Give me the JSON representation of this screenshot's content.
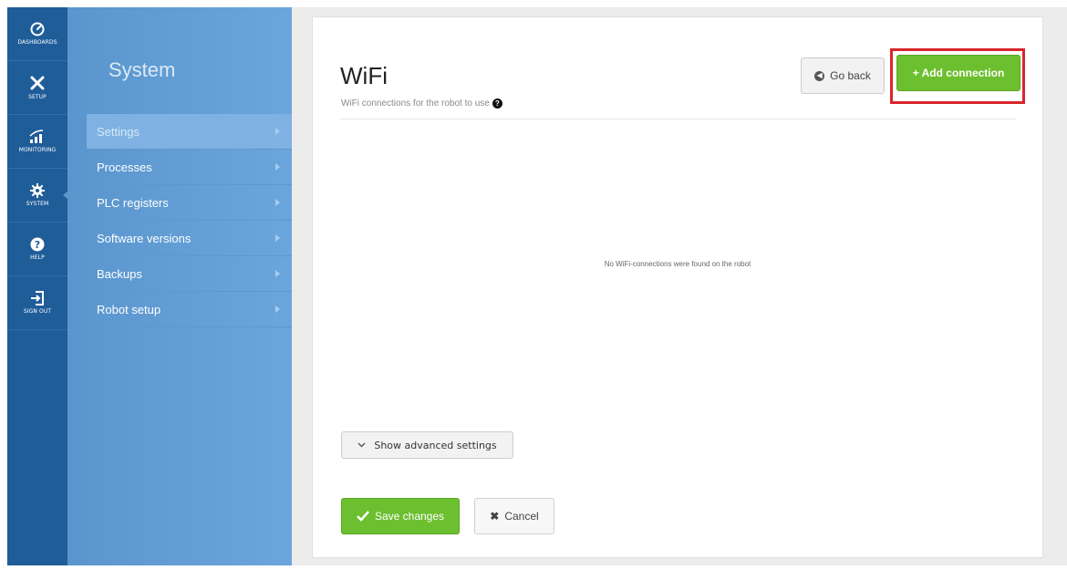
{
  "rail": {
    "items": [
      {
        "label": "DASHBOARDS",
        "icon": "dashboard-icon"
      },
      {
        "label": "SETUP",
        "icon": "tools-icon"
      },
      {
        "label": "MONITORING",
        "icon": "signal-icon"
      },
      {
        "label": "SYSTEM",
        "icon": "gear-icon",
        "active": true
      },
      {
        "label": "HELP",
        "icon": "question-icon"
      },
      {
        "label": "SIGN OUT",
        "icon": "sign-out-icon"
      }
    ]
  },
  "submenu": {
    "title": "System",
    "items": [
      {
        "label": "Settings",
        "active": true
      },
      {
        "label": "Processes"
      },
      {
        "label": "PLC registers"
      },
      {
        "label": "Software versions"
      },
      {
        "label": "Backups"
      },
      {
        "label": "Robot setup"
      }
    ]
  },
  "main": {
    "title": "WiFi",
    "subtitle": "WiFi connections for the robot to use",
    "go_back_label": "Go back",
    "add_connection_label": "+ Add connection",
    "empty_message": "No WiFi-connections were found on the robot",
    "advanced_label": "Show advanced settings",
    "save_label": "Save changes",
    "cancel_label": "Cancel"
  },
  "colors": {
    "rail": "#1f5d99",
    "submenu": "#5a95cd",
    "accent_green": "#6cbf2f",
    "highlight_red": "#d9262b"
  }
}
